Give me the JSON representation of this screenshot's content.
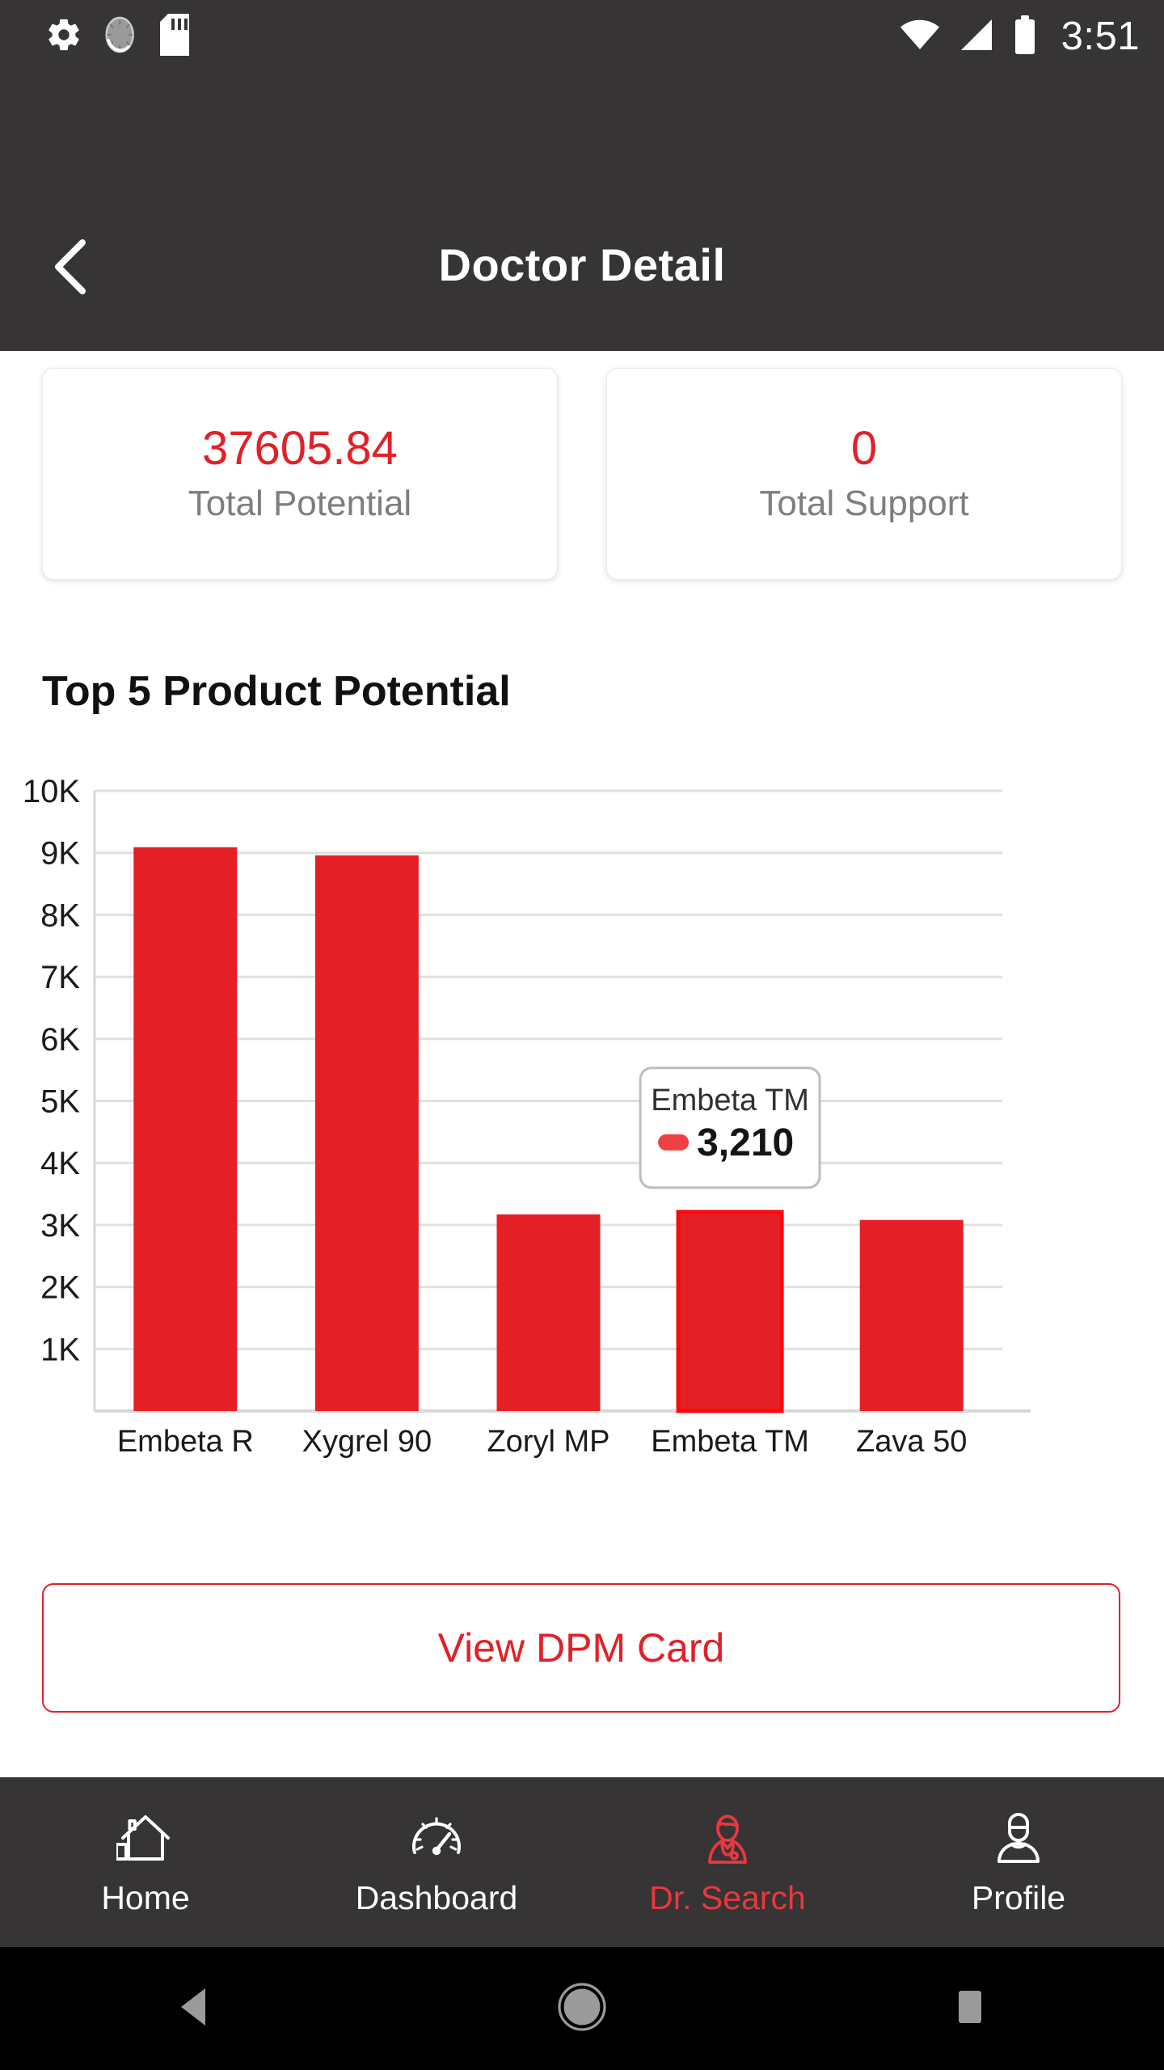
{
  "statusbar": {
    "time": "3:51",
    "icons_left": [
      "settings-gear-icon",
      "sync-circle-icon",
      "sd-card-icon"
    ],
    "icons_right": [
      "wifi-icon",
      "cellular-signal-icon",
      "battery-icon"
    ]
  },
  "header": {
    "title": "Doctor Detail",
    "back_icon": "chevron-left-icon"
  },
  "stats": [
    {
      "value": "37605.84",
      "label": "Total Potential"
    },
    {
      "value": "0",
      "label": "Total Support"
    }
  ],
  "section": {
    "title": "Top 5 Product Potential"
  },
  "chart_data": {
    "type": "bar",
    "title": "Top 5 Product Potential",
    "xlabel": "",
    "ylabel": "",
    "categories": [
      "Embeta R",
      "Xygrel 90",
      "Zoryl MP",
      "Embeta TM",
      "Zava 50"
    ],
    "values": [
      9090,
      8960,
      3170,
      3210,
      3080
    ],
    "ylim": [
      0,
      10000
    ],
    "ytick_values": [
      1000,
      2000,
      3000,
      4000,
      5000,
      6000,
      7000,
      8000,
      9000,
      10000
    ],
    "ytick_labels": [
      "1K",
      "2K",
      "3K",
      "4K",
      "5K",
      "6K",
      "7K",
      "8K",
      "9K",
      "10K"
    ],
    "grid": true,
    "legend": false,
    "bar_color": "#e42026",
    "selected_index": 3,
    "selected_outline_color": "#fa0a0f",
    "tooltip": {
      "label": "Embeta TM",
      "value": "3,210",
      "marker_color": "#ef4044"
    }
  },
  "actions": {
    "dpm_card_label": "View DPM Card"
  },
  "bottomnav": {
    "items": [
      {
        "label": "Home",
        "icon": "home-icon",
        "active": false
      },
      {
        "label": "Dashboard",
        "icon": "speedometer-icon",
        "active": false
      },
      {
        "label": "Dr. Search",
        "icon": "doctor-icon",
        "active": true
      },
      {
        "label": "Profile",
        "icon": "person-icon",
        "active": false
      }
    ],
    "active_color": "#e8383f",
    "inactive_color": "#ffffff"
  },
  "sysnav": {
    "buttons": [
      "android-back-icon",
      "android-home-icon",
      "android-recents-icon"
    ]
  }
}
